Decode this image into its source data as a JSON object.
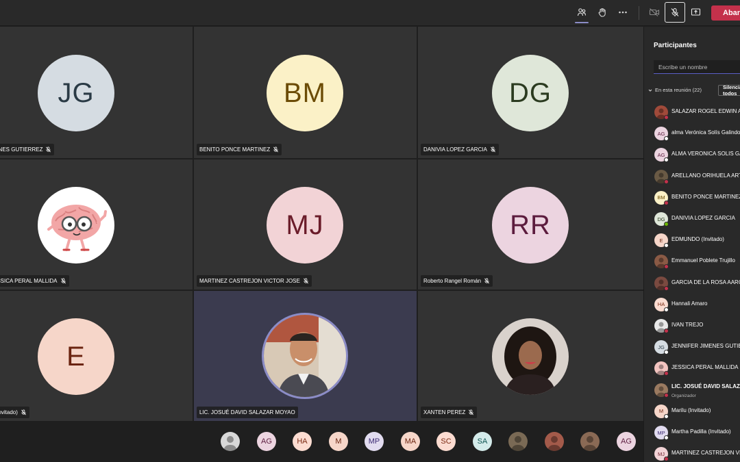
{
  "toolbar": {
    "leave_label": "Abandonar",
    "colors": {
      "leave_bg": "#c4314b",
      "accent": "#8b8cc7"
    }
  },
  "tiles": [
    {
      "initials": "JG",
      "name": "JENNIFER JIMENES GUTIERREZ",
      "bg": "#d5dce2",
      "fg": "#2a3a45"
    },
    {
      "initials": "BM",
      "name": "BENITO PONCE MARTINEZ",
      "bg": "#fbf1c7",
      "fg": "#6b4b05"
    },
    {
      "initials": "DG",
      "name": "DANIVIA LOPEZ GARCIA",
      "bg": "#dfe7d9",
      "fg": "#2b3b20"
    },
    {
      "initials": "",
      "name": "JESSICA PERAL MALLIDA",
      "bg": "#ffffff",
      "fg": "#000",
      "image": "brain-cartoon"
    },
    {
      "initials": "MJ",
      "name": "MARTINEZ CASTREJON VICTOR JOSE",
      "bg": "#f2d3d6",
      "fg": "#6a1c2a"
    },
    {
      "initials": "RR",
      "name": "Roberto Rangel Román",
      "bg": "#ecd4e0",
      "fg": "#5c1c3e"
    },
    {
      "initials": "E",
      "name": "EDMUNDO (Invitado)",
      "bg": "#f6d6c9",
      "fg": "#6b2410"
    },
    {
      "initials": "",
      "name": "LIC. JOSUÉ DAVID SALAZAR MOYAO",
      "bg": "#c9b8a6",
      "fg": "#000",
      "image": "man-photo"
    },
    {
      "initials": "",
      "name": "XANTEN PEREZ",
      "bg": "#d9d2cc",
      "fg": "#000",
      "image": "woman-photo"
    }
  ],
  "bottom_strip": [
    {
      "initials": "",
      "bg": "#d8d8d8",
      "fg": "#333",
      "photo": true
    },
    {
      "initials": "AG",
      "bg": "#ecd4e0",
      "fg": "#5c1c3e"
    },
    {
      "initials": "HA",
      "bg": "#fcdcd1",
      "fg": "#7a2a12"
    },
    {
      "initials": "M",
      "bg": "#f6d6c9",
      "fg": "#6b2410"
    },
    {
      "initials": "MP",
      "bg": "#e2dcf0",
      "fg": "#3e2d75"
    },
    {
      "initials": "MA",
      "bg": "#f6d6c9",
      "fg": "#6b2410"
    },
    {
      "initials": "SC",
      "bg": "#fcdcd1",
      "fg": "#7a2a12"
    },
    {
      "initials": "SA",
      "bg": "#d4ebea",
      "fg": "#0f5552"
    },
    {
      "initials": "",
      "bg": "#7a6a55",
      "fg": "#fff",
      "photo": true
    },
    {
      "initials": "",
      "bg": "#a35a4a",
      "fg": "#fff",
      "photo": true
    },
    {
      "initials": "",
      "bg": "#8a6a55",
      "fg": "#fff",
      "photo": true
    },
    {
      "initials": "AG",
      "bg": "#ecd4e0",
      "fg": "#5c1c3e"
    }
  ],
  "sidebar": {
    "title": "Participantes",
    "search_placeholder": "Escribe un nombre",
    "section_label": "En esta reunión (22)",
    "mute_all_label": "Silenciar a todos",
    "participants": [
      {
        "name": "SALAZAR ROGEL EDWIN A",
        "initials": "",
        "bg": "#a04a3a",
        "fg": "#fff",
        "photo": true,
        "status": "#c4314b"
      },
      {
        "name": "alma Verónica Solís Galindo",
        "initials": "AG",
        "bg": "#ecd4e0",
        "fg": "#5c1c3e",
        "status": "#ffffff"
      },
      {
        "name": "ALMA VERONICA SOLIS GALINDO",
        "initials": "AG",
        "bg": "#ecd4e0",
        "fg": "#5c1c3e",
        "status": "#ffffff"
      },
      {
        "name": "ARELLANO ORIHUELA ARTURO",
        "initials": "",
        "bg": "#6a5a45",
        "fg": "#fff",
        "photo": true,
        "status": "#c4314b"
      },
      {
        "name": "BENITO PONCE MARTINEZ",
        "initials": "BM",
        "bg": "#fbf1c7",
        "fg": "#6b4b05",
        "status": "#c4314b"
      },
      {
        "name": "DANIVIA LOPEZ GARCIA",
        "initials": "DG",
        "bg": "#dfe7d9",
        "fg": "#2b3b20",
        "status": "#6bb700"
      },
      {
        "name": "EDMUNDO (Invitado)",
        "initials": "E",
        "bg": "#f6d6c9",
        "fg": "#6b2410",
        "status": "#ffffff"
      },
      {
        "name": "Emmanuel Poblete Trujillo",
        "initials": "",
        "bg": "#8a5a45",
        "fg": "#fff",
        "photo": true,
        "status": "#c4314b"
      },
      {
        "name": "GARCIA DE LA ROSA AARON",
        "initials": "",
        "bg": "#7a4a40",
        "fg": "#fff",
        "photo": true,
        "status": "#c4314b"
      },
      {
        "name": "Hannali Amaro",
        "initials": "HA",
        "bg": "#fcdcd1",
        "fg": "#7a2a12",
        "status": "#ffffff"
      },
      {
        "name": "IVAN TREJO",
        "initials": "",
        "bg": "#e8e8e8",
        "fg": "#333",
        "photo": true,
        "status": "#c4314b"
      },
      {
        "name": "JENNIFER JIMENES GUTIERREZ",
        "initials": "JG",
        "bg": "#d5dce2",
        "fg": "#2a3a45",
        "status": "#ffffff"
      },
      {
        "name": "JESSICA PERAL MALLIDA",
        "initials": "",
        "bg": "#f3c4c0",
        "fg": "#6b2410",
        "photo": true,
        "status": "#c4314b"
      },
      {
        "name": "LIC. JOSUÉ DAVID SALAZAR MOYAO",
        "initials": "",
        "bg": "#9a7a60",
        "fg": "#fff",
        "photo": true,
        "status": "#c4314b",
        "sub": "Organizador",
        "bold": true
      },
      {
        "name": "Marilu (Invitado)",
        "initials": "M",
        "bg": "#f6d6c9",
        "fg": "#6b2410",
        "status": "#ffffff"
      },
      {
        "name": "Martha Padilla (Invitado)",
        "initials": "MP",
        "bg": "#e2dcf0",
        "fg": "#3e2d75",
        "status": "#ffffff"
      },
      {
        "name": "MARTINEZ CASTREJON VICTOR JOSE",
        "initials": "MJ",
        "bg": "#f2d3d6",
        "fg": "#6a1c2a",
        "status": "#c4314b"
      }
    ]
  }
}
